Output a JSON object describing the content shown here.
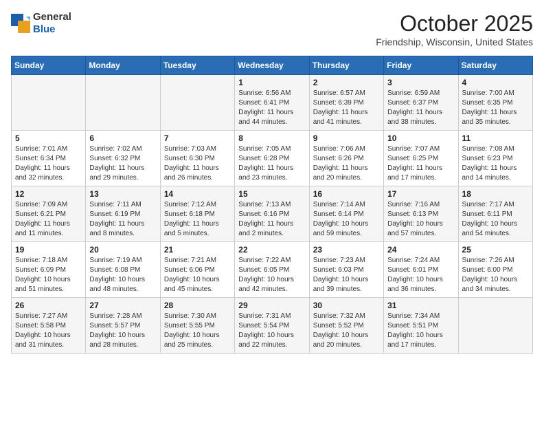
{
  "header": {
    "logo_general": "General",
    "logo_blue": "Blue",
    "month": "October 2025",
    "location": "Friendship, Wisconsin, United States"
  },
  "days_of_week": [
    "Sunday",
    "Monday",
    "Tuesday",
    "Wednesday",
    "Thursday",
    "Friday",
    "Saturday"
  ],
  "weeks": [
    [
      {
        "day": "",
        "info": ""
      },
      {
        "day": "",
        "info": ""
      },
      {
        "day": "",
        "info": ""
      },
      {
        "day": "1",
        "info": "Sunrise: 6:56 AM\nSunset: 6:41 PM\nDaylight: 11 hours and 44 minutes."
      },
      {
        "day": "2",
        "info": "Sunrise: 6:57 AM\nSunset: 6:39 PM\nDaylight: 11 hours and 41 minutes."
      },
      {
        "day": "3",
        "info": "Sunrise: 6:59 AM\nSunset: 6:37 PM\nDaylight: 11 hours and 38 minutes."
      },
      {
        "day": "4",
        "info": "Sunrise: 7:00 AM\nSunset: 6:35 PM\nDaylight: 11 hours and 35 minutes."
      }
    ],
    [
      {
        "day": "5",
        "info": "Sunrise: 7:01 AM\nSunset: 6:34 PM\nDaylight: 11 hours and 32 minutes."
      },
      {
        "day": "6",
        "info": "Sunrise: 7:02 AM\nSunset: 6:32 PM\nDaylight: 11 hours and 29 minutes."
      },
      {
        "day": "7",
        "info": "Sunrise: 7:03 AM\nSunset: 6:30 PM\nDaylight: 11 hours and 26 minutes."
      },
      {
        "day": "8",
        "info": "Sunrise: 7:05 AM\nSunset: 6:28 PM\nDaylight: 11 hours and 23 minutes."
      },
      {
        "day": "9",
        "info": "Sunrise: 7:06 AM\nSunset: 6:26 PM\nDaylight: 11 hours and 20 minutes."
      },
      {
        "day": "10",
        "info": "Sunrise: 7:07 AM\nSunset: 6:25 PM\nDaylight: 11 hours and 17 minutes."
      },
      {
        "day": "11",
        "info": "Sunrise: 7:08 AM\nSunset: 6:23 PM\nDaylight: 11 hours and 14 minutes."
      }
    ],
    [
      {
        "day": "12",
        "info": "Sunrise: 7:09 AM\nSunset: 6:21 PM\nDaylight: 11 hours and 11 minutes."
      },
      {
        "day": "13",
        "info": "Sunrise: 7:11 AM\nSunset: 6:19 PM\nDaylight: 11 hours and 8 minutes."
      },
      {
        "day": "14",
        "info": "Sunrise: 7:12 AM\nSunset: 6:18 PM\nDaylight: 11 hours and 5 minutes."
      },
      {
        "day": "15",
        "info": "Sunrise: 7:13 AM\nSunset: 6:16 PM\nDaylight: 11 hours and 2 minutes."
      },
      {
        "day": "16",
        "info": "Sunrise: 7:14 AM\nSunset: 6:14 PM\nDaylight: 10 hours and 59 minutes."
      },
      {
        "day": "17",
        "info": "Sunrise: 7:16 AM\nSunset: 6:13 PM\nDaylight: 10 hours and 57 minutes."
      },
      {
        "day": "18",
        "info": "Sunrise: 7:17 AM\nSunset: 6:11 PM\nDaylight: 10 hours and 54 minutes."
      }
    ],
    [
      {
        "day": "19",
        "info": "Sunrise: 7:18 AM\nSunset: 6:09 PM\nDaylight: 10 hours and 51 minutes."
      },
      {
        "day": "20",
        "info": "Sunrise: 7:19 AM\nSunset: 6:08 PM\nDaylight: 10 hours and 48 minutes."
      },
      {
        "day": "21",
        "info": "Sunrise: 7:21 AM\nSunset: 6:06 PM\nDaylight: 10 hours and 45 minutes."
      },
      {
        "day": "22",
        "info": "Sunrise: 7:22 AM\nSunset: 6:05 PM\nDaylight: 10 hours and 42 minutes."
      },
      {
        "day": "23",
        "info": "Sunrise: 7:23 AM\nSunset: 6:03 PM\nDaylight: 10 hours and 39 minutes."
      },
      {
        "day": "24",
        "info": "Sunrise: 7:24 AM\nSunset: 6:01 PM\nDaylight: 10 hours and 36 minutes."
      },
      {
        "day": "25",
        "info": "Sunrise: 7:26 AM\nSunset: 6:00 PM\nDaylight: 10 hours and 34 minutes."
      }
    ],
    [
      {
        "day": "26",
        "info": "Sunrise: 7:27 AM\nSunset: 5:58 PM\nDaylight: 10 hours and 31 minutes."
      },
      {
        "day": "27",
        "info": "Sunrise: 7:28 AM\nSunset: 5:57 PM\nDaylight: 10 hours and 28 minutes."
      },
      {
        "day": "28",
        "info": "Sunrise: 7:30 AM\nSunset: 5:55 PM\nDaylight: 10 hours and 25 minutes."
      },
      {
        "day": "29",
        "info": "Sunrise: 7:31 AM\nSunset: 5:54 PM\nDaylight: 10 hours and 22 minutes."
      },
      {
        "day": "30",
        "info": "Sunrise: 7:32 AM\nSunset: 5:52 PM\nDaylight: 10 hours and 20 minutes."
      },
      {
        "day": "31",
        "info": "Sunrise: 7:34 AM\nSunset: 5:51 PM\nDaylight: 10 hours and 17 minutes."
      },
      {
        "day": "",
        "info": ""
      }
    ]
  ]
}
